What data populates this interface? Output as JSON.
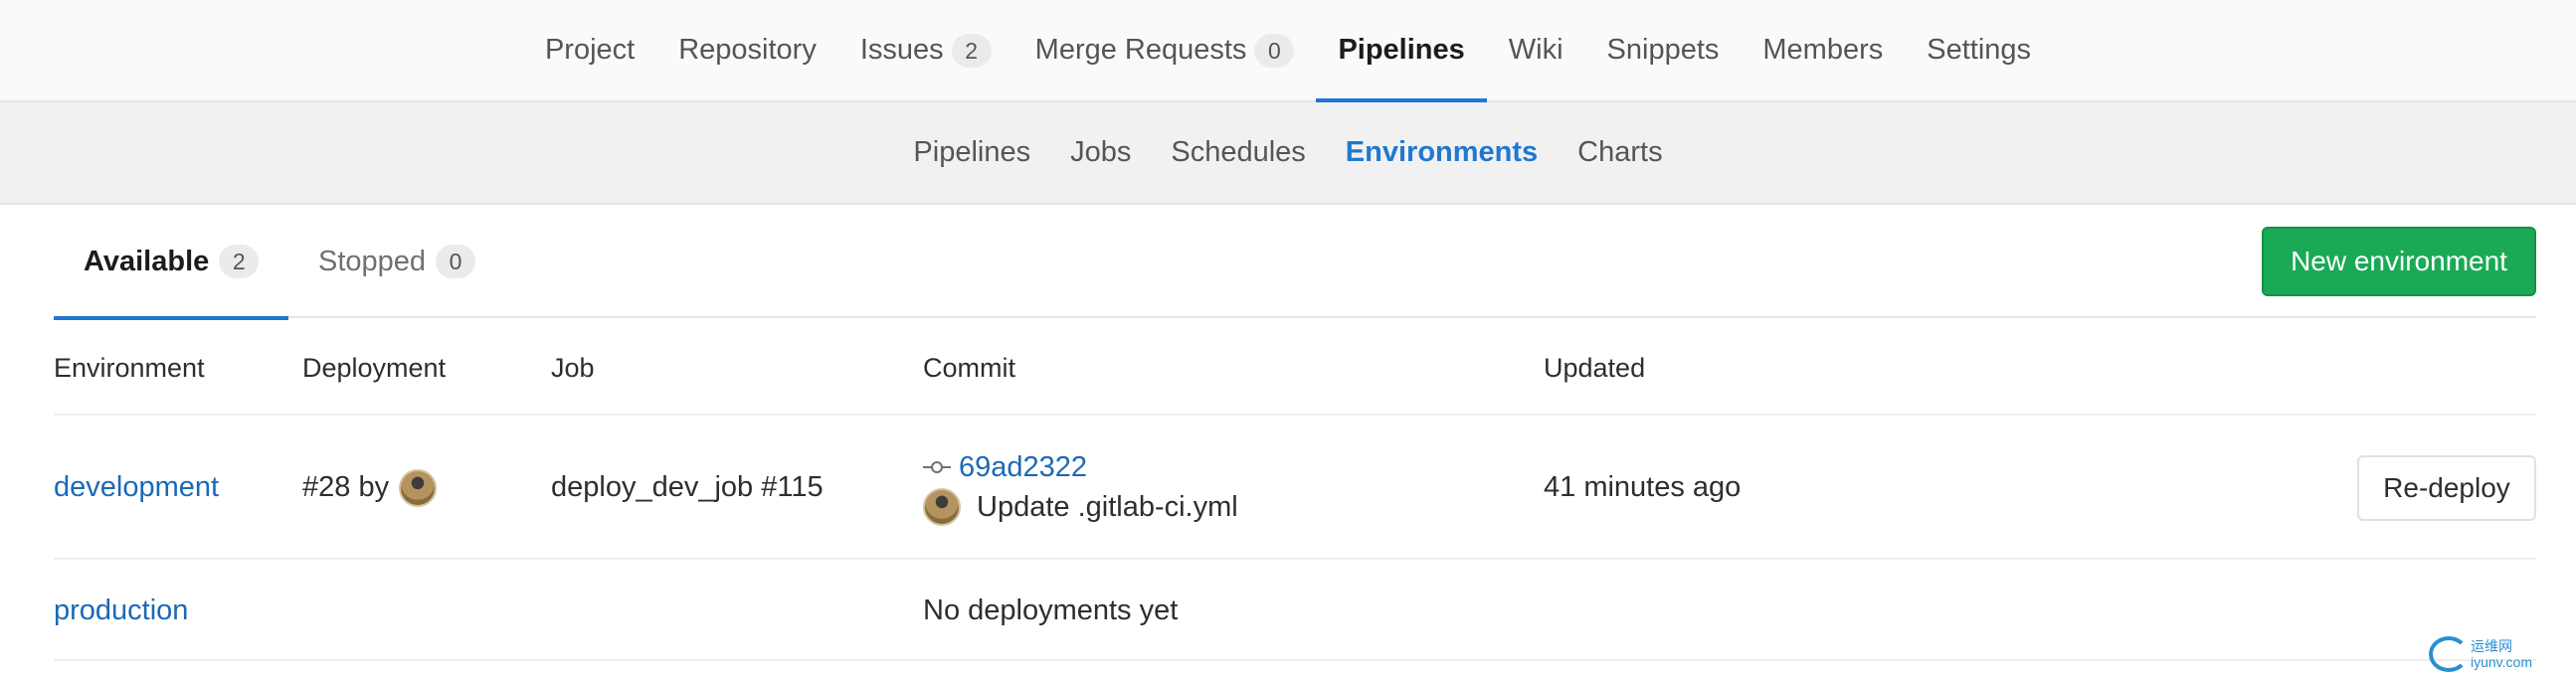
{
  "top_nav": {
    "items": [
      {
        "label": "Project"
      },
      {
        "label": "Repository"
      },
      {
        "label": "Issues",
        "badge": "2"
      },
      {
        "label": "Merge Requests",
        "badge": "0"
      },
      {
        "label": "Pipelines",
        "active": true
      },
      {
        "label": "Wiki"
      },
      {
        "label": "Snippets"
      },
      {
        "label": "Members"
      },
      {
        "label": "Settings"
      }
    ]
  },
  "sub_nav": {
    "items": [
      {
        "label": "Pipelines"
      },
      {
        "label": "Jobs"
      },
      {
        "label": "Schedules"
      },
      {
        "label": "Environments",
        "active": true
      },
      {
        "label": "Charts"
      }
    ]
  },
  "tabs": {
    "available": {
      "label": "Available",
      "count": "2"
    },
    "stopped": {
      "label": "Stopped",
      "count": "0"
    }
  },
  "new_environment_label": "New environment",
  "table": {
    "headers": {
      "environment": "Environment",
      "deployment": "Deployment",
      "job": "Job",
      "commit": "Commit",
      "updated": "Updated"
    },
    "rows": [
      {
        "environment": "development",
        "deployment": "#28 by",
        "job": "deploy_dev_job #115",
        "commit_sha": "69ad2322",
        "commit_title": "Update .gitlab-ci.yml",
        "updated": "41 minutes ago",
        "action": "Re-deploy"
      },
      {
        "environment": "production",
        "no_deployments": "No deployments yet"
      }
    ]
  },
  "watermark": {
    "line1": "运维网",
    "line2": "iyunv.com"
  },
  "colors": {
    "link": "#1b69b6",
    "active_underline": "#1f78d1",
    "success_button": "#1aaa55"
  }
}
